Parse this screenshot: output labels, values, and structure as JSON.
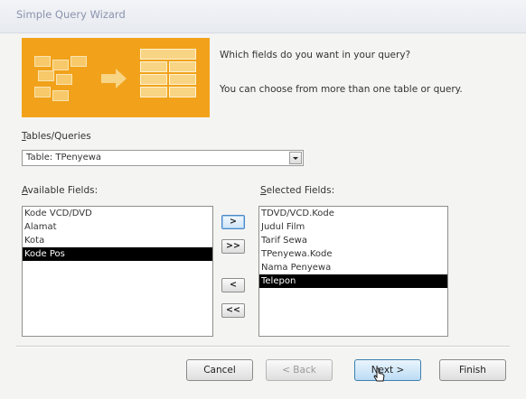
{
  "window": {
    "title": "Simple Query Wizard"
  },
  "instructions": {
    "line1": "Which fields do you want in your query?",
    "line2": "You can choose from more than one table or query."
  },
  "tables_queries": {
    "label_underlined": "T",
    "label_rest": "ables/Queries",
    "selected": "Table: TPenyewa"
  },
  "available_fields": {
    "label_underlined": "A",
    "label_rest": "vailable Fields:",
    "items": [
      "Kode VCD/DVD",
      "Alamat",
      "Kota",
      "Kode Pos"
    ],
    "selected_index": 3
  },
  "selected_fields": {
    "label_underlined": "S",
    "label_rest": "elected Fields:",
    "items": [
      "TDVD/VCD.Kode",
      "Judul Film",
      "Tarif Sewa",
      "TPenyewa.Kode",
      "Nama Penyewa",
      "Telepon"
    ],
    "selected_index": 5
  },
  "move_buttons": {
    "add_one": ">",
    "add_all": ">>",
    "remove_one": "<",
    "remove_all": "<<"
  },
  "buttons": {
    "cancel": "Cancel",
    "back": "< Back",
    "next": "Next >",
    "finish": "Finish"
  },
  "colors": {
    "illustration_bg": "#f1a21a",
    "selection_bg": "#000000",
    "next_hover": "#bcdcf4"
  }
}
